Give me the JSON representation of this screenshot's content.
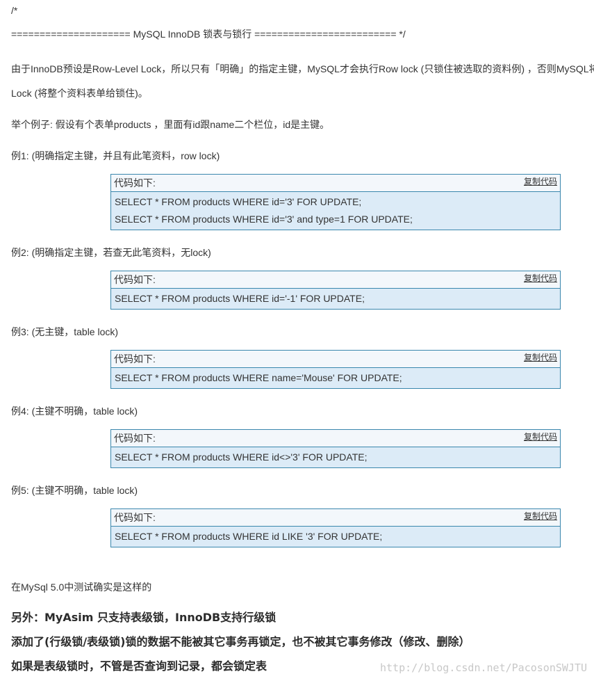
{
  "article": {
    "comment_open": "/*",
    "title_line": " ===================== MySQL InnoDB 锁表与锁行 ========================= */",
    "intro_line1": "由于InnoDB预设是Row-Level Lock，所以只有「明确」的指定主键，MySQL才会执行Row lock (只锁住被选取的资料例) ，否则MySQL将会",
    "intro_line2": "Lock (将整个资料表单给锁住)。",
    "example_intro": "举个例子: 假设有个表单products ，里面有id跟name二个栏位，id是主键。",
    "code_header_label": "代码如下:",
    "copy_label": "复制代码",
    "examples": [
      {
        "label": "例1: (明确指定主键，并且有此笔资料，row lock)",
        "code": [
          "SELECT * FROM products WHERE id='3' FOR UPDATE;",
          "SELECT * FROM products WHERE id='3' and type=1 FOR UPDATE;"
        ]
      },
      {
        "label": "例2: (明确指定主键，若查无此笔资料，无lock)",
        "code": [
          "SELECT * FROM products WHERE id='-1' FOR UPDATE;"
        ]
      },
      {
        "label": "例3: (无主键，table lock)",
        "code": [
          "SELECT * FROM products WHERE name='Mouse' FOR UPDATE;"
        ]
      },
      {
        "label": "例4: (主键不明确，table lock)",
        "code": [
          "SELECT * FROM products WHERE id<>'3' FOR UPDATE;"
        ]
      },
      {
        "label": "例5: (主键不明确，table lock)",
        "code": [
          "SELECT * FROM products WHERE id LIKE '3' FOR UPDATE;"
        ]
      }
    ],
    "tested_note": "在MySql 5.0中测试确实是这样的",
    "bold_lines": [
      "另外：MyAsim 只支持表级锁，InnoDB支持行级锁",
      "添加了(行级锁/表级锁)锁的数据不能被其它事务再锁定，也不被其它事务修改（修改、删除）",
      "如果是表级锁时，不管是否查询到记录，都会锁定表"
    ],
    "watermark": "http://blog.csdn.net/PacosonSWJTU"
  }
}
